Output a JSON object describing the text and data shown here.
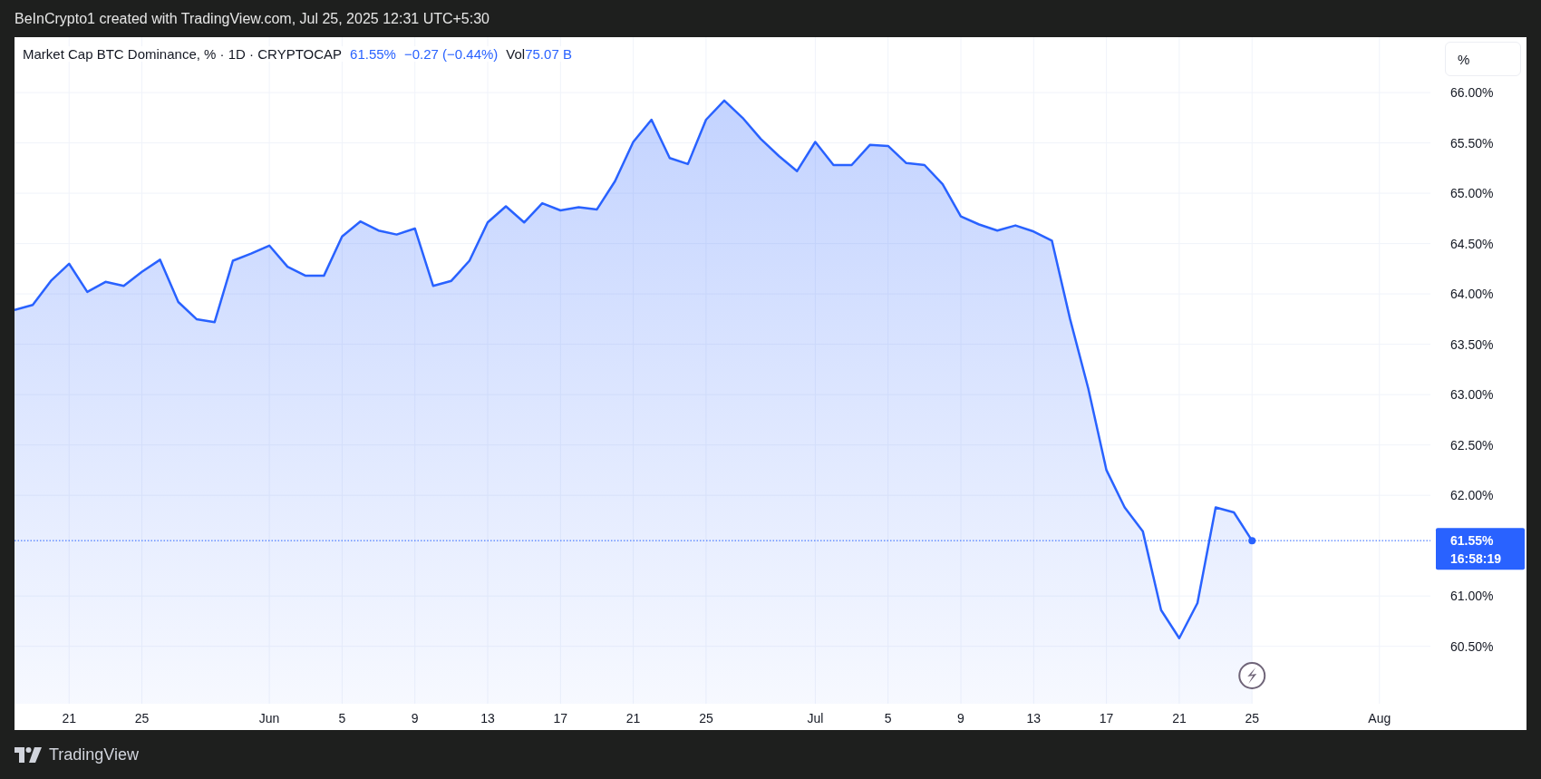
{
  "header": {
    "caption": "BeInCrypto1 created with TradingView.com, Jul 25, 2025 12:31 UTC+5:30"
  },
  "legend": {
    "title": "Market Cap BTC Dominance, % · 1D · CRYPTOCAP",
    "price": "61.55%",
    "change": "−0.27 (−0.44%)",
    "volume_label": "Vol",
    "volume": "75.07 B"
  },
  "scale_button": {
    "label": "%"
  },
  "price_label": {
    "price": "61.55%",
    "countdown": "16:58:19"
  },
  "chart_data": {
    "type": "area",
    "categories": [
      null,
      null,
      null,
      "21",
      null,
      null,
      null,
      "25",
      null,
      null,
      null,
      null,
      null,
      null,
      "Jun",
      null,
      null,
      null,
      "5",
      null,
      null,
      null,
      "9",
      null,
      null,
      null,
      "13",
      null,
      null,
      null,
      "17",
      null,
      null,
      null,
      "21",
      null,
      null,
      null,
      "25",
      null,
      null,
      null,
      null,
      null,
      "Jul",
      null,
      null,
      null,
      "5",
      null,
      null,
      null,
      "9",
      null,
      null,
      null,
      "13",
      null,
      null,
      null,
      "17",
      null,
      null,
      null,
      "21",
      null,
      null,
      null,
      "25",
      null,
      null,
      null,
      null,
      null,
      null,
      "Aug",
      null,
      null
    ],
    "series": [
      {
        "color": "#2962ff",
        "values": [
          63.84,
          63.89,
          64.13,
          64.3,
          64.02,
          64.12,
          64.08,
          64.22,
          64.34,
          63.92,
          63.75,
          63.72,
          64.33,
          64.4,
          64.48,
          64.27,
          64.18,
          64.18,
          64.57,
          64.72,
          64.63,
          64.59,
          64.65,
          64.08,
          64.13,
          64.33,
          64.71,
          64.87,
          64.71,
          64.9,
          64.83,
          64.86,
          64.84,
          65.12,
          65.51,
          65.73,
          65.35,
          65.29,
          65.73,
          65.92,
          65.75,
          65.54,
          65.37,
          65.22,
          65.51,
          65.28,
          65.28,
          65.48,
          65.47,
          65.3,
          65.28,
          65.09,
          64.77,
          64.69,
          64.63,
          64.68,
          64.62,
          64.53,
          63.75,
          63.06,
          62.25,
          61.88,
          61.64,
          60.86,
          60.58,
          60.93,
          61.88,
          61.83,
          61.55,
          null,
          null,
          null,
          null,
          null,
          null,
          null,
          null,
          null
        ]
      }
    ],
    "ylim": [
      59.93,
      66.55
    ],
    "grid": true,
    "ref_lines": [
      {
        "axis": "y",
        "value": 61.55
      }
    ],
    "yticks": [
      {
        "value": 66,
        "label": "66.00%"
      },
      {
        "value": 65.5,
        "label": "65.50%"
      },
      {
        "value": 65,
        "label": "65.00%"
      },
      {
        "value": 64.5,
        "label": "64.50%"
      },
      {
        "value": 64,
        "label": "64.00%"
      },
      {
        "value": 63.5,
        "label": "63.50%"
      },
      {
        "value": 63,
        "label": "63.00%"
      },
      {
        "value": 62.5,
        "label": "62.50%"
      },
      {
        "value": 62,
        "label": "62.00%"
      },
      {
        "value": 61,
        "label": "61.00%"
      },
      {
        "value": 60.5,
        "label": "60.50%"
      }
    ]
  },
  "footer": {
    "brand": "TradingView"
  }
}
